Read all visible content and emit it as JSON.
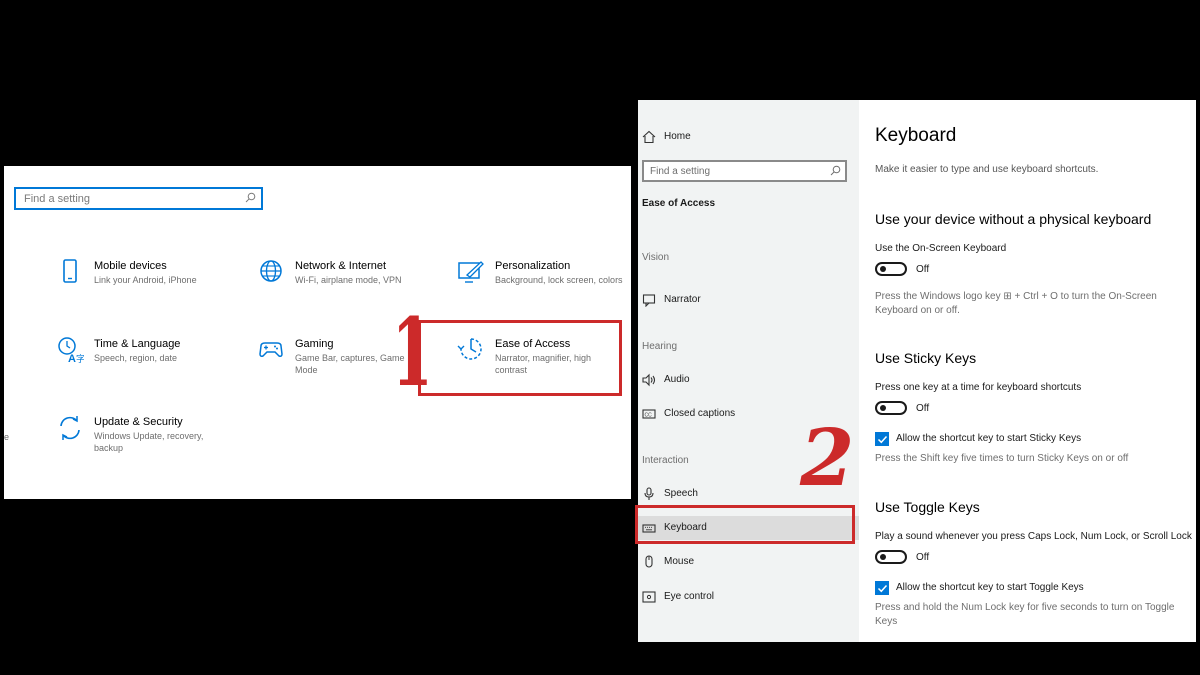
{
  "settings_home": {
    "search_placeholder": "Find a setting",
    "categories": [
      {
        "title": "Mobile devices",
        "desc": "Link your Android, iPhone"
      },
      {
        "title": "Network & Internet",
        "desc": "Wi-Fi, airplane mode, VPN"
      },
      {
        "title": "Personalization",
        "desc": "Background, lock screen, colors"
      },
      {
        "title": "Time & Language",
        "desc": "Speech, region, date"
      },
      {
        "title": "Gaming",
        "desc": "Game Bar, captures, Game Mode"
      },
      {
        "title": "Ease of Access",
        "desc": "Narrator, magnifier, high contrast"
      },
      {
        "title": "Update & Security",
        "desc": "Windows Update, recovery, backup"
      }
    ],
    "annotation": "1"
  },
  "ease_of_access": {
    "home_label": "Home",
    "search_placeholder": "Find a setting",
    "section_title": "Ease of Access",
    "groups": {
      "vision": "Vision",
      "hearing": "Hearing",
      "interaction": "Interaction"
    },
    "items": {
      "narrator": "Narrator",
      "audio": "Audio",
      "closed_captions": "Closed captions",
      "speech": "Speech",
      "keyboard": "Keyboard",
      "mouse": "Mouse",
      "eye_control": "Eye control"
    },
    "annotation": "2"
  },
  "keyboard_page": {
    "title": "Keyboard",
    "subtitle": "Make it easier to type and use keyboard shortcuts.",
    "osk": {
      "heading": "Use your device without a physical keyboard",
      "label": "Use the On-Screen Keyboard",
      "state": "Off",
      "hint": "Press the Windows logo key ⊞ + Ctrl + O to turn the On-Screen Keyboard on or off."
    },
    "sticky": {
      "heading": "Use Sticky Keys",
      "label": "Press one key at a time for keyboard shortcuts",
      "state": "Off",
      "checkbox": "Allow the shortcut key to start Sticky Keys",
      "hint": "Press the Shift key five times to turn Sticky Keys on or off"
    },
    "toggle_keys": {
      "heading": "Use Toggle Keys",
      "label": "Play a sound whenever you press Caps Lock, Num Lock, or Scroll Lock",
      "state": "Off",
      "checkbox": "Allow the shortcut key to start Toggle Keys",
      "hint": "Press and hold the Num Lock key for five seconds to turn on Toggle Keys"
    }
  },
  "colors": {
    "accent": "#0078d7",
    "annotation_red": "#cc2a2a"
  }
}
